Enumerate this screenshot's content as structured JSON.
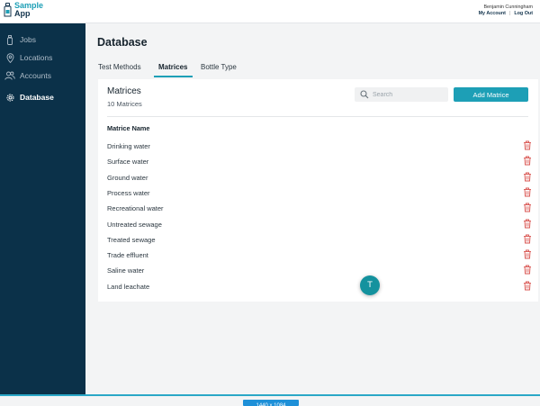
{
  "app": {
    "name_line1": "Sample",
    "name_line2": "App"
  },
  "user": {
    "name": "Benjamin Cunningham",
    "my_account": "My Account",
    "separator": "|",
    "logout": "Log Out"
  },
  "sidebar": {
    "items": [
      {
        "label": "Jobs",
        "icon": "bottle-icon",
        "active": false
      },
      {
        "label": "Locations",
        "icon": "map-pin-icon",
        "active": false
      },
      {
        "label": "Accounts",
        "icon": "users-icon",
        "active": false
      },
      {
        "label": "Database",
        "icon": "gear-icon",
        "active": true
      }
    ]
  },
  "page": {
    "title": "Database"
  },
  "tabs": [
    {
      "label": "Test Methods",
      "active": false
    },
    {
      "label": "Matrices",
      "active": true
    },
    {
      "label": "Bottle Type",
      "active": false
    }
  ],
  "panel": {
    "title": "Matrices",
    "subtitle": "10 Matrices",
    "search_placeholder": "Search",
    "add_label": "Add Matrice",
    "column_header": "Matrice Name",
    "rows": [
      "Drinking water",
      "Surface water",
      "Ground water",
      "Process water",
      "Recreational water",
      "Untreated sewage",
      "Treated sewage",
      "Trade effluent",
      "Saline water",
      "Land leachate"
    ]
  },
  "avatar": {
    "initial": "T"
  },
  "viewport_badge": "1440 x 1084",
  "colors": {
    "accent": "#1d9fb6",
    "sidebar_bg": "#0b3149",
    "danger": "#d9534f"
  }
}
